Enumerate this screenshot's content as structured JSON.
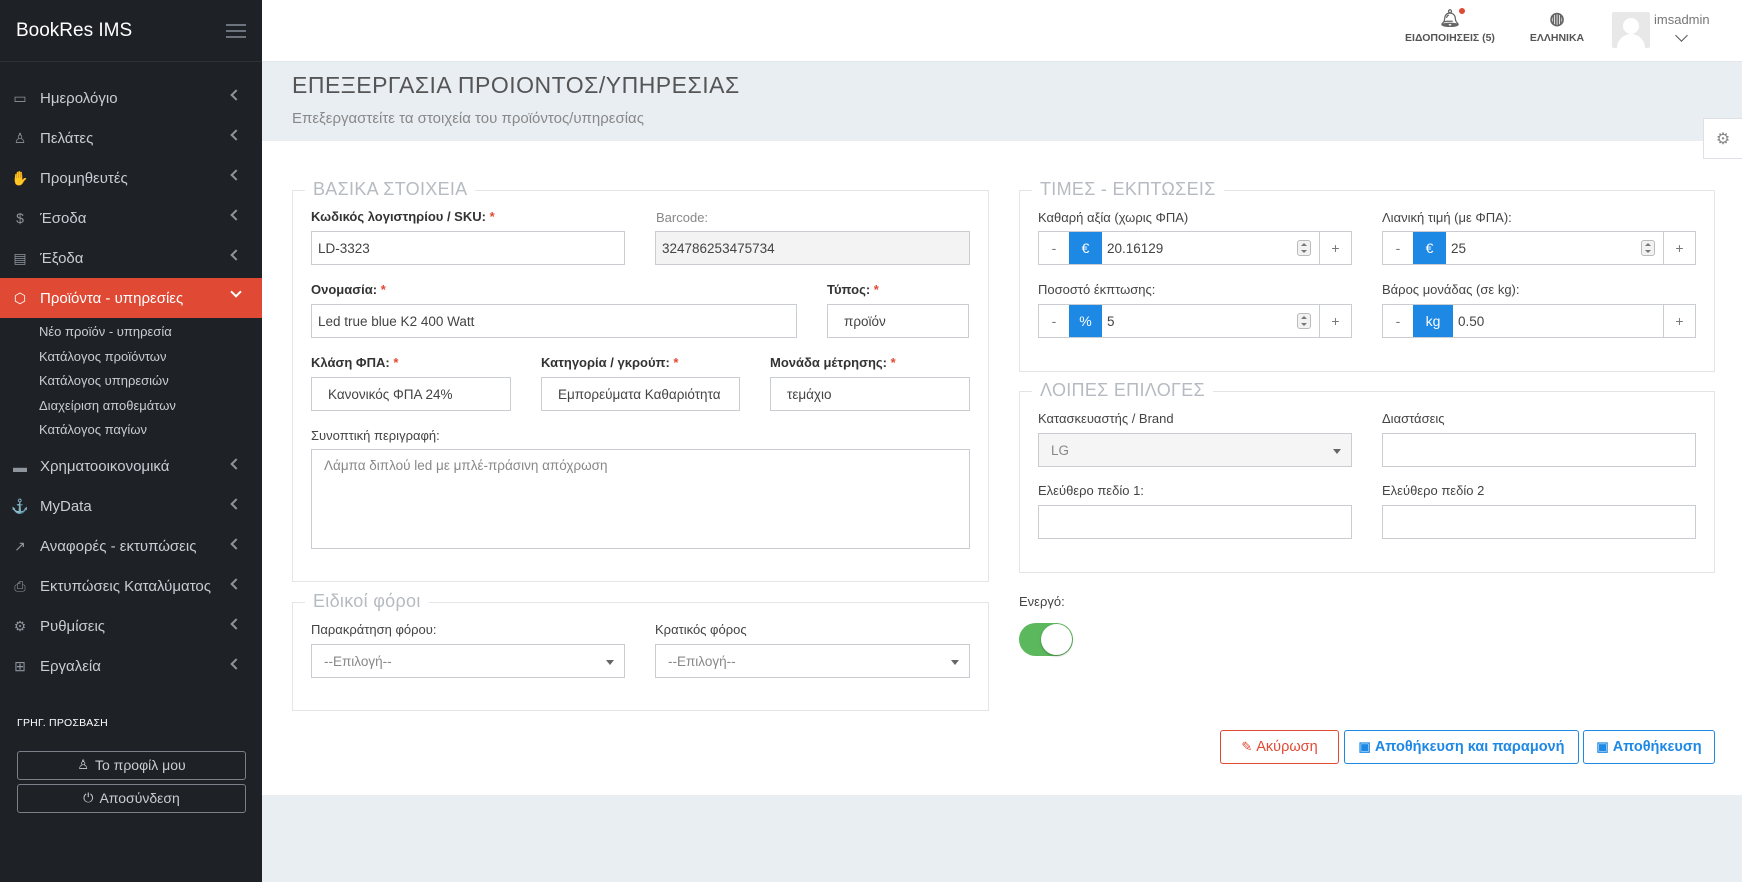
{
  "app": {
    "brand": "BookRes IMS"
  },
  "sidebar": {
    "items": [
      {
        "label": "Ημερολόγιο",
        "icon": "calendar-icon"
      },
      {
        "label": "Πελάτες",
        "icon": "user-icon"
      },
      {
        "label": "Προμηθευτές",
        "icon": "hand-icon"
      },
      {
        "label": "Έσοδα",
        "icon": "dollar-icon"
      },
      {
        "label": "Έξοδα",
        "icon": "book-icon"
      },
      {
        "label": "Προϊόντα - υπηρεσίες",
        "icon": "box-icon"
      },
      {
        "label": "Χρηματοοικονομικά",
        "icon": "money-icon"
      },
      {
        "label": "MyData",
        "icon": "anchor-icon"
      },
      {
        "label": "Αναφορές - εκτυπώσεις",
        "icon": "chart-line-icon"
      },
      {
        "label": "Εκτυπώσεις Καταλύματος",
        "icon": "printer-icon"
      },
      {
        "label": "Ρυθμίσεις",
        "icon": "settings-icon"
      },
      {
        "label": "Εργαλεία",
        "icon": "toolbox-icon"
      }
    ],
    "submenu": [
      "Νέο προϊόν - υπηρεσία",
      "Κατάλογος προϊόντων",
      "Κατάλογος υπηρεσιών",
      "Διαχείριση αποθεμάτων",
      "Κατάλογος παγίων"
    ],
    "quick_access": "ΓΡΗΓ. ΠΡΟΣΒΑΣΗ",
    "profile_button": "Το προφίλ μου",
    "logout_button": "Αποσύνδεση"
  },
  "topbar": {
    "notifications": "ΕΙΔΟΠΟΙΗΣΕΙΣ (5)",
    "language": "ΕΛΛΗΝΙΚΑ",
    "username": "imsadmin"
  },
  "page": {
    "title": "ΕΠΕΞΕΡΓΑΣΙΑ ΠΡΟΙΟΝΤΟΣ/ΥΠΗΡΕΣΙΑΣ",
    "subtitle": "Επεξεργαστείτε τα στοιχεία του προϊόντος/υπηρεσίας"
  },
  "basic": {
    "legend": "ΒΑΣΙΚΑ ΣΤΟΙΧΕΙΑ",
    "sku_label": "Κωδικός λογιστηρίου / SKU:",
    "sku_value": "LD-3323",
    "barcode_label": "Barcode:",
    "barcode_value": "324786253475734",
    "name_label": "Ονομασία:",
    "name_value": "Led true blue K2 400 Watt",
    "type_label": "Τύπος:",
    "type_value": "προϊόν",
    "vat_label": "Κλάση ΦΠΑ:",
    "vat_value": "Κανονικός ΦΠΑ 24%",
    "category_label": "Κατηγορία / γκρούπ:",
    "category_value": "Εμπορεύματα Καθαριότητα",
    "unit_label": "Μονάδα μέτρησης:",
    "unit_value": "τεμάχιο",
    "desc_label": "Συνοπτική περιγραφή:",
    "desc_value": "Λάμπα διπλού led με μπλέ-πράσινη απόχρωση",
    "required_mark": "*"
  },
  "taxes": {
    "legend": "Ειδικοί φόροι",
    "withholding_label": "Παρακράτηση φόρου:",
    "withholding_value": "--Επιλογή--",
    "state_label": "Κρατικός φόρος",
    "state_value": "--Επιλογή--"
  },
  "prices": {
    "legend": "ΤΙΜΕΣ - ΕΚΠΤΩΣΕΙΣ",
    "net_label": "Καθαρή αξία (χωρις ΦΠΑ)",
    "net_addon": "€",
    "net_value": "20.16129",
    "retail_label": "Λιανική τιμή (με ΦΠΑ):",
    "retail_addon": "€",
    "retail_value": "25",
    "discount_label": "Ποσοστό έκπτωσης:",
    "discount_addon": "%",
    "discount_value": "5",
    "weight_label": "Βάρος μονάδας (σε kg):",
    "weight_addon": "kg",
    "weight_value": "0.50",
    "minus": "-",
    "plus": "+"
  },
  "other": {
    "legend": "ΛΟΙΠΕΣ ΕΠΙΛΟΓΕΣ",
    "brand_label": "Κατασκευαστής / Brand",
    "brand_value": "LG",
    "dims_label": "Διαστάσεις",
    "dims_value": "",
    "free1_label": "Ελεύθερο πεδίο 1:",
    "free1_value": "",
    "free2_label": "Ελεύθερο πεδίο 2",
    "free2_value": ""
  },
  "active": {
    "label": "Ενεργό:",
    "value": true
  },
  "actions": {
    "cancel": "Ακύρωση",
    "save_stay": "Αποθήκευση και παραμονή",
    "save": "Αποθήκευση"
  },
  "colors": {
    "accent": "#1e88e5",
    "active_menu": "#e04a34",
    "toggle_on": "#5cb85c",
    "sidebar_bg": "#1e2126"
  }
}
